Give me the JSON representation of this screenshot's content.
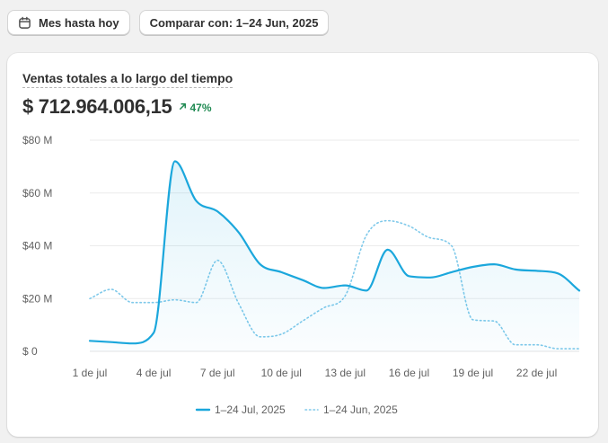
{
  "toolbar": {
    "date_range_label": "Mes hasta hoy",
    "compare_label": "Comparar con: 1–24 Jun, 2025"
  },
  "card": {
    "title": "Ventas totales a lo largo del tiempo",
    "total": "$ 712.964.006,15",
    "change": "47%",
    "change_color": "#1f8a52"
  },
  "chart_data": {
    "type": "line",
    "x": [
      "1 de jul",
      "2 de jul",
      "3 de jul",
      "4 de jul",
      "5 de jul",
      "6 de jul",
      "7 de jul",
      "8 de jul",
      "9 de jul",
      "10 de jul",
      "11 de jul",
      "12 de jul",
      "13 de jul",
      "14 de jul",
      "15 de jul",
      "16 de jul",
      "17 de jul",
      "18 de jul",
      "19 de jul",
      "20 de jul",
      "21 de jul",
      "22 de jul",
      "23 de jul",
      "24 de jul"
    ],
    "xticks": [
      "1 de jul",
      "4 de jul",
      "7 de jul",
      "10 de jul",
      "13 de jul",
      "16 de jul",
      "19 de jul",
      "22 de jul"
    ],
    "yticks": [
      "$ 0",
      "$20 M",
      "$40 M",
      "$60 M",
      "$80 M"
    ],
    "ylim": [
      0,
      80
    ],
    "yunit": "M",
    "grid": true,
    "legend_position": "bottom-center",
    "series": [
      {
        "name": "1–24 Jul, 2025",
        "style": "solid",
        "color": "#1ba7dc",
        "fill": true,
        "values": [
          4,
          3.5,
          3,
          7,
          72,
          57,
          53,
          45,
          33,
          30,
          27,
          24,
          25,
          23,
          38.5,
          28.5,
          28,
          30,
          32,
          33,
          31,
          30.5,
          29.5,
          23
        ]
      },
      {
        "name": "1–24 Jun, 2025",
        "style": "dotted",
        "color": "#7fc9ea",
        "fill": false,
        "values": [
          20,
          23.5,
          18.5,
          18.5,
          19.5,
          18.5,
          34.5,
          18,
          5.5,
          6.5,
          11.5,
          16.5,
          21,
          44,
          49.5,
          47.5,
          43,
          40,
          12,
          11.5,
          2.5,
          2.5,
          1,
          1
        ]
      }
    ]
  }
}
